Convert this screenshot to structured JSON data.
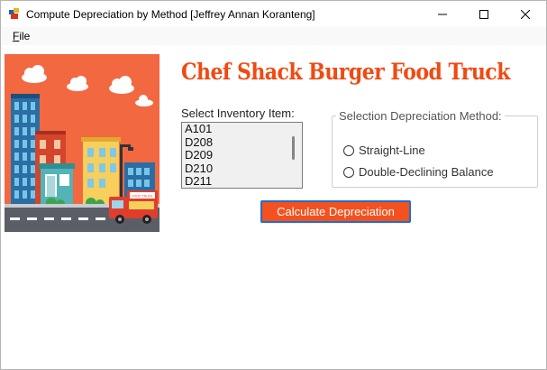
{
  "window": {
    "title": "Compute Depreciation by Method [Jeffrey Annan Koranteng]"
  },
  "menu": {
    "file_prefix": "F",
    "file_rest": "ile"
  },
  "heading": "Chef Shack Burger Food Truck",
  "inventory": {
    "label": "Select Inventory Item:",
    "items": [
      "A101",
      "D208",
      "D209",
      "D210",
      "D211"
    ]
  },
  "method": {
    "legend": "Selection Depreciation Method:",
    "options": [
      "Straight-Line",
      "Double-Declining Balance"
    ]
  },
  "calculate_label": "Calculate Depreciation",
  "illustration": {
    "truck_sign": "FOOD TRUCK"
  },
  "colors": {
    "accent": "#f04a12",
    "button_bg": "#f4511e",
    "button_border": "#1f6fcf",
    "sky": "#f26840",
    "road": "#5b5e66"
  }
}
